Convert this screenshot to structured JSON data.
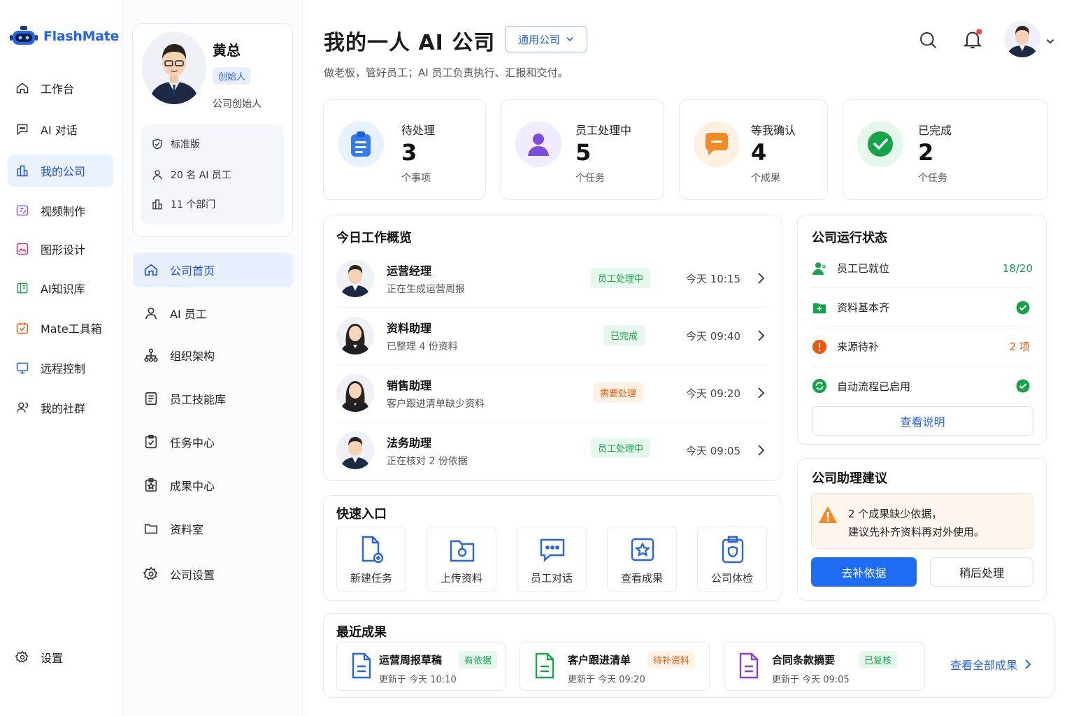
{
  "app": {
    "name": "FlashMate"
  },
  "nav": {
    "items": [
      {
        "label": "工作台",
        "icon": "home-icon"
      },
      {
        "label": "AI 对话",
        "icon": "chat-icon"
      },
      {
        "label": "我的公司",
        "icon": "building-icon"
      },
      {
        "label": "视频制作",
        "icon": "video-edit-icon"
      },
      {
        "label": "图形设计",
        "icon": "image-icon"
      },
      {
        "label": "AI知识库",
        "icon": "book-icon"
      },
      {
        "label": "Mate工具箱",
        "icon": "toolbox-icon"
      },
      {
        "label": "远程控制",
        "icon": "monitor-icon"
      },
      {
        "label": "我的社群",
        "icon": "users-icon"
      }
    ],
    "settings_label": "设置"
  },
  "profile": {
    "name": "黄总",
    "badge": "创始人",
    "role": "公司创始人",
    "plan": "标准版",
    "employees": "20 名 AI 员工",
    "departments": "11 个部门"
  },
  "subnav": {
    "items": [
      {
        "label": "公司首页"
      },
      {
        "label": "AI 员工"
      },
      {
        "label": "组织架构"
      },
      {
        "label": "员工技能库"
      },
      {
        "label": "任务中心"
      },
      {
        "label": "成果中心"
      },
      {
        "label": "资料室"
      },
      {
        "label": "公司设置"
      }
    ]
  },
  "header": {
    "title": "我的一人 AI 公司",
    "company_type": "通用公司",
    "subtitle": "做老板，管好员工；AI 员工负责执行、汇报和交付。"
  },
  "stats": [
    {
      "label": "待处理",
      "value": "3",
      "unit": "个事项",
      "color": "#2f7cf6"
    },
    {
      "label": "员工处理中",
      "value": "5",
      "unit": "个任务",
      "color": "#7c4ddc"
    },
    {
      "label": "等我确认",
      "value": "4",
      "unit": "个成果",
      "color": "#f08a24"
    },
    {
      "label": "已完成",
      "value": "2",
      "unit": "个任务",
      "color": "#16a34a"
    }
  ],
  "work": {
    "title": "今日工作概览",
    "rows": [
      {
        "name": "运营经理",
        "desc": "正在生成运营周报",
        "status": "员工处理中",
        "time": "今天 10:15"
      },
      {
        "name": "资料助理",
        "desc": "已整理 4 份资料",
        "status": "已完成",
        "time": "今天 09:40"
      },
      {
        "name": "销售助理",
        "desc": "客户跟进清单缺少资料",
        "status": "需要处理",
        "time": "今天 09:20"
      },
      {
        "name": "法务助理",
        "desc": "正在核对 2 份依据",
        "status": "员工处理中",
        "time": "今天 09:05"
      }
    ]
  },
  "company_status": {
    "title": "公司运行状态",
    "rows": [
      {
        "label": "员工已就位",
        "value": "18/20"
      },
      {
        "label": "资料基本齐",
        "value": ""
      },
      {
        "label": "来源待补",
        "value": "2 项"
      },
      {
        "label": "自动流程已启用",
        "value": ""
      }
    ],
    "button": "查看说明"
  },
  "advice": {
    "title": "公司助理建议",
    "line1": "2 个成果缺少依据，",
    "line2": "建议先补齐资料再对外使用。",
    "primary": "去补依据",
    "secondary": "稍后处理"
  },
  "quick": {
    "title": "快速入口",
    "items": [
      {
        "label": "新建任务"
      },
      {
        "label": "上传资料"
      },
      {
        "label": "员工对话"
      },
      {
        "label": "查看成果"
      },
      {
        "label": "公司体检"
      }
    ]
  },
  "results": {
    "title": "最近成果",
    "items": [
      {
        "name": "运营周报草稿",
        "tag": "有依据",
        "updated": "更新于  今天 10:10"
      },
      {
        "name": "客户跟进清单",
        "tag": "待补资料",
        "updated": "更新于  今天 09:20"
      },
      {
        "name": "合同条款摘要",
        "tag": "已复核",
        "updated": "更新于  今天 09:05"
      }
    ],
    "view_all": "查看全部成果"
  }
}
